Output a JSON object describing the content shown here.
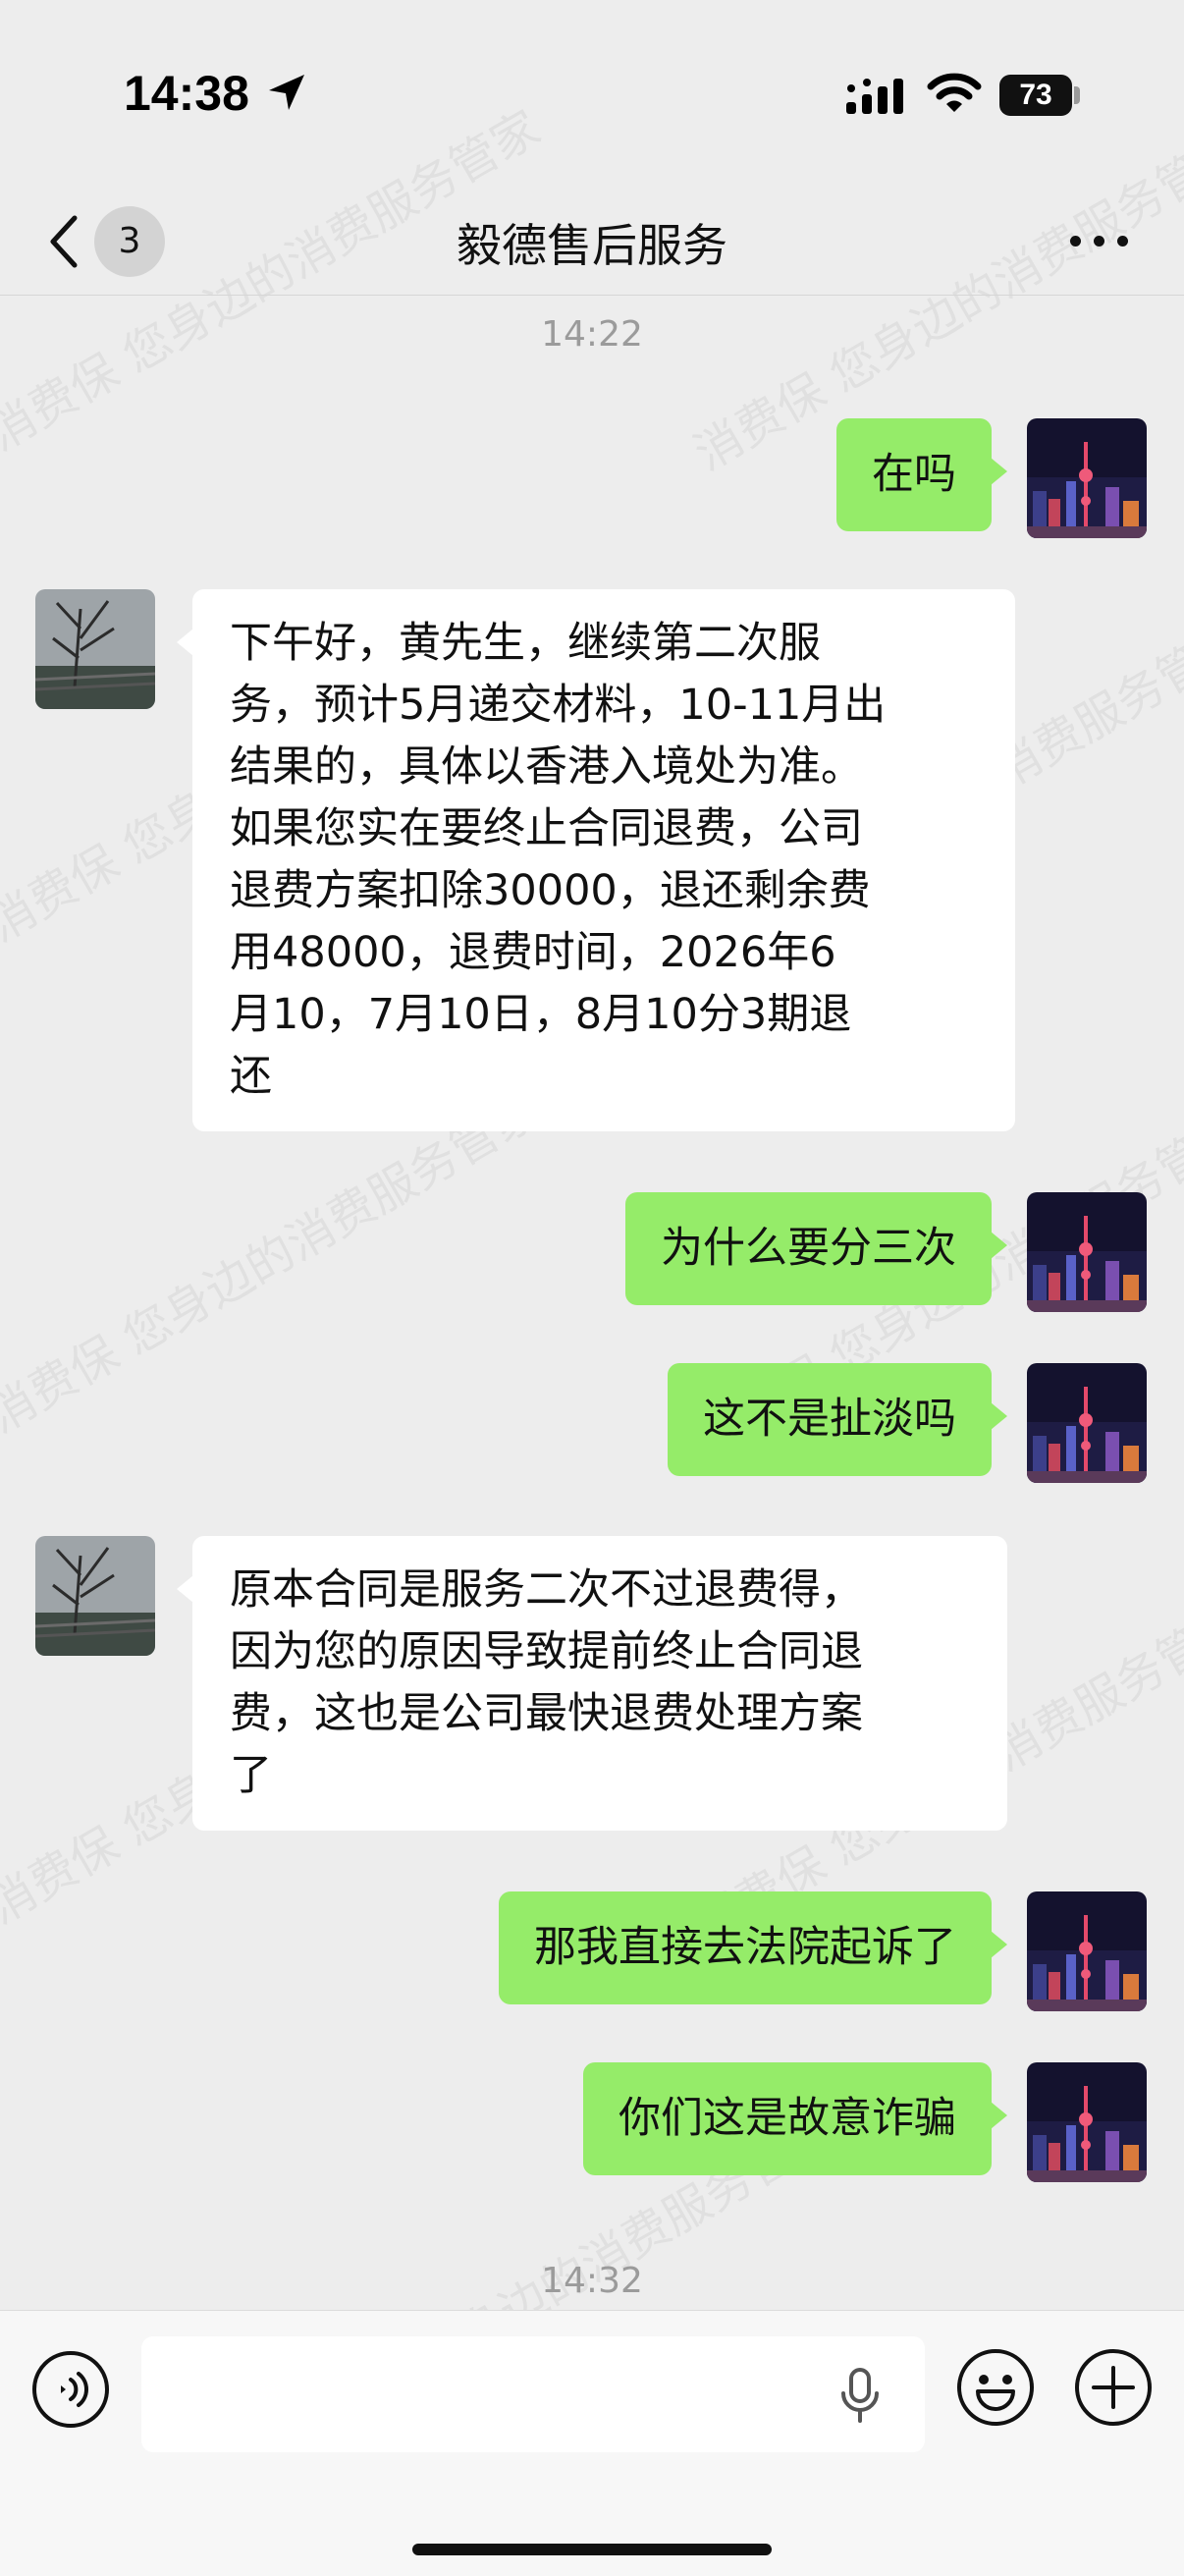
{
  "status_bar": {
    "time": "14:38",
    "battery": "73"
  },
  "header": {
    "unread_count": "3",
    "title": "毅德售后服务"
  },
  "watermark": {
    "text": "消费保 您身边的消费服务管家"
  },
  "timestamps": [
    "14:22",
    "14:32"
  ],
  "messages": [
    {
      "sender": "me",
      "text": "在吗"
    },
    {
      "sender": "contact",
      "text": "下午好，黄先生，继续第二次服\n务，预计5月递交材料，10-11月出\n结果的，具体以香港入境处为准。\n如果您实在要终止合同退费，公司\n退费方案扣除30000，退还剩余费\n用48000，退费时间，2026年6\n月10，7月10日，8月10分3期退\n还"
    },
    {
      "sender": "me",
      "text": "为什么要分三次"
    },
    {
      "sender": "me",
      "text": "这不是扯淡吗"
    },
    {
      "sender": "contact",
      "text": "原本合同是服务二次不过退费得，\n因为您的原因导致提前终止合同退\n费，这也是公司最快退费处理方案\n了"
    },
    {
      "sender": "me",
      "text": "那我直接去法院起诉了"
    },
    {
      "sender": "me",
      "text": "你们这是故意诈骗"
    }
  ],
  "colors": {
    "sent_bubble": "#95ec69",
    "received_bubble": "#ffffff",
    "background": "#ededed"
  },
  "icons": [
    "back-chevron-icon",
    "more-dots-icon",
    "location-arrow-icon",
    "signal-icon",
    "wifi-icon",
    "voice-icon",
    "microphone-icon",
    "emoji-icon",
    "plus-icon"
  ]
}
